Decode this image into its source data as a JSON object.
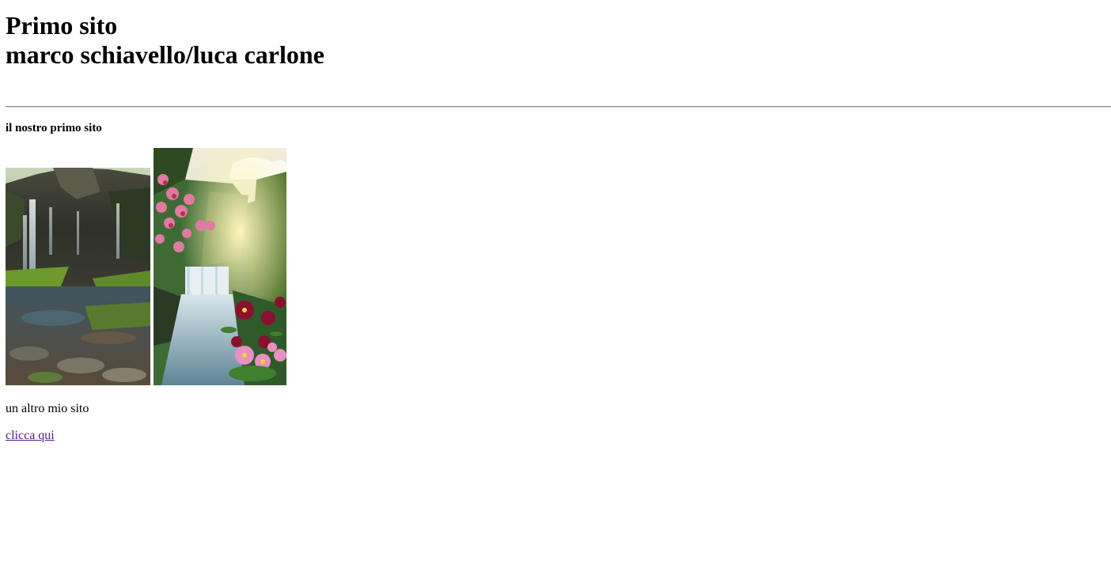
{
  "header": {
    "title_line1": "Primo sito",
    "title_line2": "marco schiavello/luca carlone"
  },
  "main": {
    "subtitle": "il nostro primo sito",
    "images": [
      {
        "name": "waterfall-rocks-image"
      },
      {
        "name": "waterfall-flowers-image"
      }
    ],
    "paragraph": "un altro mio sito",
    "link_label": "clicca qui"
  },
  "colors": {
    "link_visited": "#551a8b",
    "rule": "#8a8a8a",
    "background": "#ffffff",
    "text": "#000000"
  }
}
